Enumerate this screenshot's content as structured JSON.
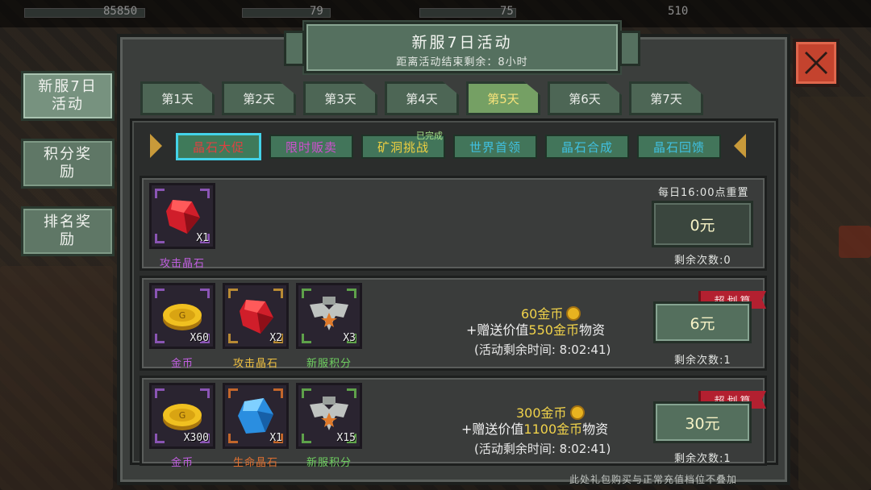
{
  "hud": {
    "gold": "85850",
    "energy": "79",
    "stamina": "75",
    "gems": "510"
  },
  "side_tabs": [
    {
      "label": "新服7日\n活动",
      "active": true
    },
    {
      "label": "积分奖\n励",
      "active": false
    },
    {
      "label": "排名奖\n励",
      "active": false
    }
  ],
  "header": {
    "title": "新服7日活动",
    "subtitle": "距离活动结束剩余：8小时"
  },
  "day_tabs": [
    {
      "label": "第1天"
    },
    {
      "label": "第2天"
    },
    {
      "label": "第3天"
    },
    {
      "label": "第4天"
    },
    {
      "label": "第5天",
      "active": true
    },
    {
      "label": "第6天"
    },
    {
      "label": "第7天"
    }
  ],
  "sub_tabs": [
    {
      "label": "晶石大促",
      "color": "#e04040",
      "active": true
    },
    {
      "label": "限时贩卖",
      "color": "#d04fd0"
    },
    {
      "label": "矿洞挑战",
      "color": "#f0d040"
    },
    {
      "label": "世界首领",
      "color": "#40c0e0"
    },
    {
      "label": "晶石合成",
      "color": "#40c0e0"
    },
    {
      "label": "晶石回馈",
      "color": "#40c0e0"
    }
  ],
  "completed_mark": "已完成",
  "offers": [
    {
      "items": [
        {
          "name": "攻击晶石",
          "qty": "X1",
          "name_color": "#c05fe0",
          "icon": "red-crystal-icon"
        }
      ],
      "reset_note": "每日16:00点重置",
      "price": "0元",
      "remaining": "剩余次数:0"
    },
    {
      "items": [
        {
          "name": "金币",
          "qty": "X60",
          "name_color": "#c05fe0",
          "icon": "gold-coin-icon"
        },
        {
          "name": "攻击晶石",
          "qty": "X2",
          "name_color": "#f0c040",
          "icon": "red-crystal-icon"
        },
        {
          "name": "新服积分",
          "qty": "X3",
          "name_color": "#6fd060",
          "icon": "eagle-badge-icon"
        }
      ],
      "line1": "60金币",
      "line2_prefix": "+赠送价值",
      "line2_value": "550金币",
      "line2_suffix": "物资",
      "timer": "(活动剩余时间: 8:02:41)",
      "tag": "超划算",
      "price": "6元",
      "remaining": "剩余次数:1"
    },
    {
      "items": [
        {
          "name": "金币",
          "qty": "X300",
          "name_color": "#c05fe0",
          "icon": "gold-coin-icon"
        },
        {
          "name": "生命晶石",
          "qty": "X1",
          "name_color": "#e07030",
          "icon": "blue-crystal-icon"
        },
        {
          "name": "新服积分",
          "qty": "X15",
          "name_color": "#6fd060",
          "icon": "eagle-badge-icon"
        }
      ],
      "line1": "300金币",
      "line2_prefix": "+赠送价值",
      "line2_value": "1100金币",
      "line2_suffix": "物资",
      "timer": "(活动剩余时间: 8:02:41)",
      "tag": "超划算",
      "price": "30元",
      "remaining": "剩余次数:1"
    }
  ],
  "footer_note": "此处礼包购买与正常充值档位不叠加"
}
